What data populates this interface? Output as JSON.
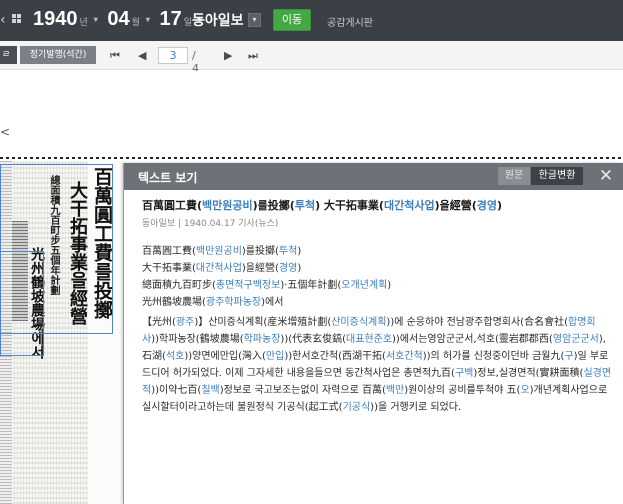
{
  "topbar": {
    "prev_arrow": "‹",
    "year": "1940",
    "year_unit": "년",
    "month": "04",
    "month_unit": "월",
    "day": "17",
    "day_unit": "일",
    "date_arrow": "▾",
    "newspaper": "동아일보",
    "newspaper_arrow": "▾",
    "go_label": "이동",
    "board_label": "공감게시판"
  },
  "subbar": {
    "tab1_label": "ㄹ",
    "tab2_label": "정기발행(석간)",
    "first_label": "⏮",
    "prev_label": "◀",
    "page_current": "3",
    "page_total": "/ 4",
    "next_label": "▶",
    "last_label": "⏭"
  },
  "workspace": {
    "back_arrow": "<",
    "scan": {
      "headline_1": "百萬圓工費를投擲",
      "headline_2": "大干拓事業을經營",
      "subhead": "總面積九百町步五個年計劃",
      "farm": "光州鶴坡農場에서"
    }
  },
  "panel": {
    "title": "텍스트 보기",
    "toggle_original": "원문",
    "toggle_korean": "한글변환",
    "close_label": "✕",
    "article": {
      "title": [
        {
          "t": "百萬圓工費("
        },
        {
          "t": "백만원공비",
          "k": true
        },
        {
          "t": ")를投擲("
        },
        {
          "t": "투척",
          "k": true
        },
        {
          "t": ") 大干拓事業("
        },
        {
          "t": "대간척사업",
          "k": true
        },
        {
          "t": ")을經營("
        },
        {
          "t": "경영",
          "k": true
        },
        {
          "t": ")"
        }
      ],
      "meta": "동아일보 | 1940.04.17 기사(뉴스)",
      "lines": [
        [
          {
            "t": "百萬圓工費("
          },
          {
            "t": "백만원공비",
            "k": true
          },
          {
            "t": ")를投擲("
          },
          {
            "t": "투척",
            "k": true
          },
          {
            "t": ")"
          }
        ],
        [
          {
            "t": "大干拓事業("
          },
          {
            "t": "대간척사업",
            "k": true
          },
          {
            "t": ")을經營("
          },
          {
            "t": "경영",
            "k": true
          },
          {
            "t": ")"
          }
        ],
        [
          {
            "t": "總面積九百町步("
          },
          {
            "t": "총면적구백정보",
            "k": true
          },
          {
            "t": ")·五個年計劃("
          },
          {
            "t": "오개년계획",
            "k": true
          },
          {
            "t": ")"
          }
        ],
        [
          {
            "t": "光州鶴坡農場("
          },
          {
            "t": "광주학파농장",
            "k": true
          },
          {
            "t": ")에서"
          }
        ]
      ],
      "body": [
        {
          "t": "【光州("
        },
        {
          "t": "광주",
          "k": true
        },
        {
          "t": ")】산미증식계획(産米增殖計劃("
        },
        {
          "t": "산미증식계획",
          "k": true
        },
        {
          "t": "))에 순응하야 전남광주합명회사(合名會社("
        },
        {
          "t": "합명회사",
          "k": true
        },
        {
          "t": "))학파농장(鶴坡農場("
        },
        {
          "t": "학파농장",
          "k": true
        },
        {
          "t": "))(代表玄俊鎬("
        },
        {
          "t": "대표현준호",
          "k": true
        },
        {
          "t": "))에서는영암군군서,석호(靈岩郡郡西("
        },
        {
          "t": "영암군군서",
          "k": true
        },
        {
          "t": "),石湖("
        },
        {
          "t": "석호",
          "k": true
        },
        {
          "t": "))양면에만입(灣入("
        },
        {
          "t": "만입",
          "k": true
        },
        {
          "t": "))한서호간척(西湖干拓("
        },
        {
          "t": "서호간척",
          "k": true
        },
        {
          "t": "))의 허가를 신청중이던바 금월九("
        },
        {
          "t": "구",
          "k": true
        },
        {
          "t": ")일 부로드디어 허가되었다. 이제 그자세한 내용을들으면 동간척사업은 총면적九百("
        },
        {
          "t": "구백",
          "k": true
        },
        {
          "t": ")정보,실경면적(實耕面積("
        },
        {
          "t": "실경면적",
          "k": true
        },
        {
          "t": "))이약七百("
        },
        {
          "t": "칠백",
          "k": true
        },
        {
          "t": ")정보로 국고보조는없이 자력으로 百萬("
        },
        {
          "t": "백만",
          "k": true
        },
        {
          "t": ")원이상의 공비를투척야 五("
        },
        {
          "t": "오",
          "k": true
        },
        {
          "t": ")개년계획사업으로 실시할터이라고하는데 불원정식 기공식(起工式("
        },
        {
          "t": "기공식",
          "k": true
        },
        {
          "t": "))을 거행키로 되었다."
        }
      ]
    }
  }
}
